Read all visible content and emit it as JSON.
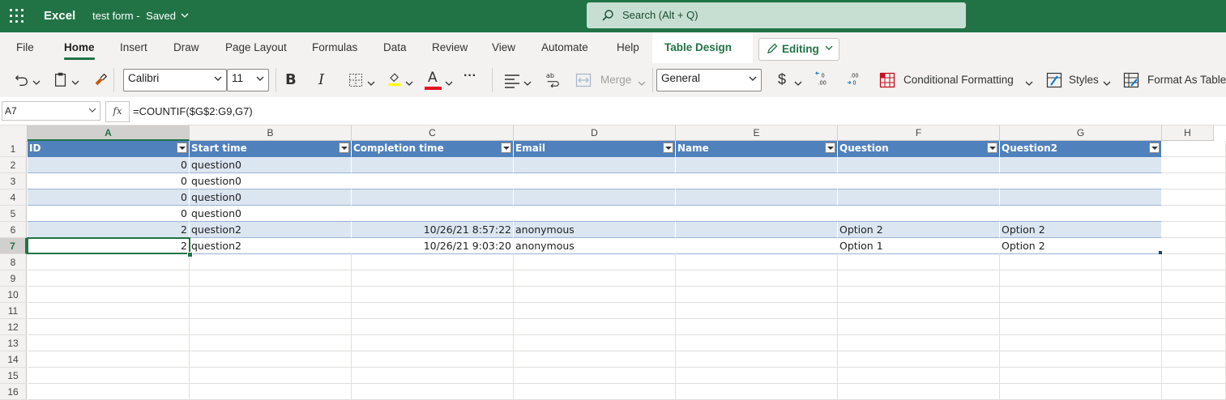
{
  "app": {
    "name": "Excel",
    "doc_title": "test form",
    "doc_status": "Saved"
  },
  "search": {
    "placeholder": "Search (Alt + Q)"
  },
  "tabs": [
    "File",
    "Home",
    "Insert",
    "Draw",
    "Page Layout",
    "Formulas",
    "Data",
    "Review",
    "View",
    "Automate",
    "Help"
  ],
  "active_tab": "Home",
  "contextual_tab": "Table Design",
  "mode_button": "Editing",
  "ribbon": {
    "font_name": "Calibri",
    "font_size": "11",
    "bold_label": "B",
    "italic_label": "I",
    "font_color_label": "A",
    "merge_label": "Merge",
    "number_format": "General",
    "currency_label": "$",
    "conditional_formatting_label": "Conditional Formatting",
    "styles_label": "Styles",
    "format_as_table_label": "Format As Table",
    "more_label": "···"
  },
  "formula_bar": {
    "name_box": "A7",
    "fx_label": "fx",
    "formula": "=COUNTIF($G$2:G9,G7)"
  },
  "columns": [
    "A",
    "B",
    "C",
    "D",
    "E",
    "F",
    "G",
    "H"
  ],
  "rows": [
    "1",
    "2",
    "3",
    "4",
    "5",
    "6",
    "7",
    "8",
    "9",
    "10",
    "11",
    "12",
    "13",
    "14",
    "15",
    "16"
  ],
  "table": {
    "headers": [
      "ID",
      "Start time",
      "Completion time",
      "Email",
      "Name",
      "Question",
      "Question2"
    ],
    "data": [
      [
        "0",
        "question0",
        "",
        "",
        "",
        "",
        ""
      ],
      [
        "0",
        "question0",
        "",
        "",
        "",
        "",
        ""
      ],
      [
        "0",
        "question0",
        "",
        "",
        "",
        "",
        ""
      ],
      [
        "0",
        "question0",
        "",
        "",
        "",
        "",
        ""
      ],
      [
        "2",
        "question2",
        "10/26/21 8:57:22",
        "anonymous",
        "",
        "Option 2",
        "Option 2"
      ],
      [
        "2",
        "question2",
        "10/26/21 9:03:20",
        "anonymous",
        "",
        "Option 1",
        "Option 2"
      ]
    ]
  },
  "colors": {
    "brand": "#217346",
    "table_header": "#4f81bd",
    "table_band": "#dce6f1",
    "search_bg": "#c7dfd2"
  }
}
